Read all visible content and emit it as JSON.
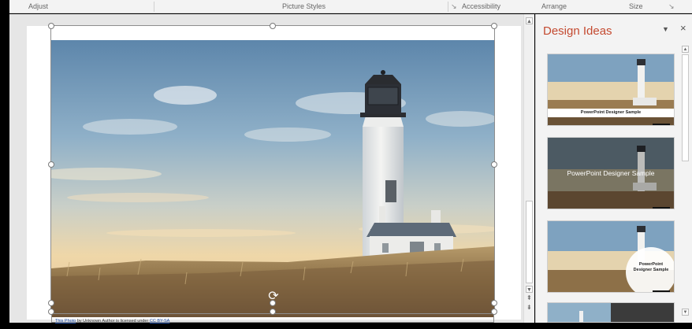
{
  "ribbon": {
    "groups": [
      "Adjust",
      "Picture Styles",
      "Accessibility",
      "Arrange",
      "Size"
    ]
  },
  "slide": {
    "credit_link": "This Photo",
    "credit_mid": "by Unknown Author is licensed under",
    "credit_license": "CC BY-SA"
  },
  "design_pane": {
    "title": "Design Ideas",
    "menu_icon": "dropdown-icon",
    "close_label": "×",
    "ideas": [
      {
        "caption": "PowerPoint Designer Sample"
      },
      {
        "caption": "PowerPoint Designer Sample"
      },
      {
        "caption_line1": "PowerPoint",
        "caption_line2": "Designer Sample"
      }
    ]
  },
  "colors": {
    "accent_title": "#c44a30",
    "sky_top": "#6b91b3",
    "sky_glow": "#f0d6a6",
    "grass": "#8a6e45"
  }
}
